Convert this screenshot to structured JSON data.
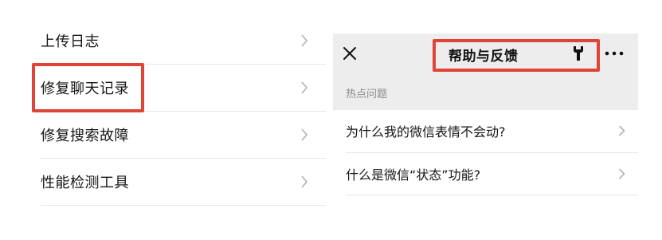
{
  "settings_list": {
    "items": [
      {
        "label": "上传日志"
      },
      {
        "label": "修复聊天记录"
      },
      {
        "label": "修复搜索故障"
      },
      {
        "label": "性能检测工具"
      }
    ]
  },
  "help_panel": {
    "title": "帮助与反馈",
    "section_title": "热点问题",
    "faq_items": [
      {
        "label": "为什么我的微信表情不会动?"
      },
      {
        "label": "什么是微信“状态”功能?"
      }
    ]
  },
  "colors": {
    "highlight": "#e04437",
    "header_bg": "#ededed",
    "divider": "#e6e6e6",
    "chevron": "#b2b2b2"
  },
  "icons": {
    "close": "close-icon",
    "wrench": "wrench-icon",
    "more": "more-icon",
    "chevron": "chevron-right-icon"
  }
}
